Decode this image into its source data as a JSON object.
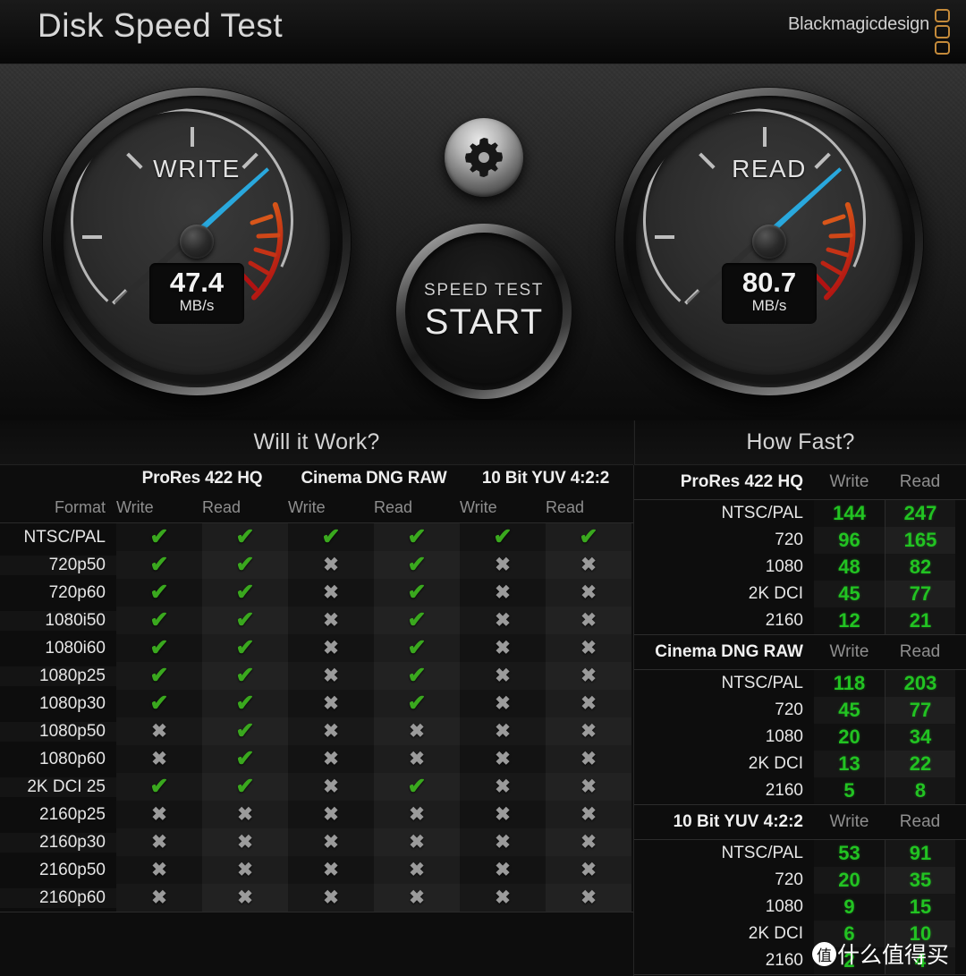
{
  "titlebar": {
    "app_title": "Disk Speed Test",
    "brand": "Blackmagicdesign"
  },
  "gauges": {
    "write": {
      "label": "WRITE",
      "value": "47.4",
      "unit": "MB/s",
      "needle_angle_deg": 228
    },
    "read": {
      "label": "READ",
      "value": "80.7",
      "unit": "MB/s",
      "needle_angle_deg": 228
    }
  },
  "controls": {
    "gear_icon": "gear-icon",
    "start_sub": "SPEED TEST",
    "start_main": "START"
  },
  "sections": {
    "left_title": "Will it Work?",
    "right_title": "How Fast?"
  },
  "will_it_work": {
    "groups": [
      "ProRes 422 HQ",
      "Cinema DNG RAW",
      "10 Bit YUV 4:2:2"
    ],
    "format_header": "Format",
    "sub_headers": [
      "Write",
      "Read",
      "Write",
      "Read",
      "Write",
      "Read"
    ],
    "rows": [
      {
        "format": "NTSC/PAL",
        "cells": [
          "ok",
          "ok",
          "ok",
          "ok",
          "ok",
          "ok"
        ]
      },
      {
        "format": "720p50",
        "cells": [
          "ok",
          "ok",
          "no",
          "ok",
          "no",
          "no"
        ]
      },
      {
        "format": "720p60",
        "cells": [
          "ok",
          "ok",
          "no",
          "ok",
          "no",
          "no"
        ]
      },
      {
        "format": "1080i50",
        "cells": [
          "ok",
          "ok",
          "no",
          "ok",
          "no",
          "no"
        ]
      },
      {
        "format": "1080i60",
        "cells": [
          "ok",
          "ok",
          "no",
          "ok",
          "no",
          "no"
        ]
      },
      {
        "format": "1080p25",
        "cells": [
          "ok",
          "ok",
          "no",
          "ok",
          "no",
          "no"
        ]
      },
      {
        "format": "1080p30",
        "cells": [
          "ok",
          "ok",
          "no",
          "ok",
          "no",
          "no"
        ]
      },
      {
        "format": "1080p50",
        "cells": [
          "no",
          "ok",
          "no",
          "no",
          "no",
          "no"
        ]
      },
      {
        "format": "1080p60",
        "cells": [
          "no",
          "ok",
          "no",
          "no",
          "no",
          "no"
        ]
      },
      {
        "format": "2K DCI 25",
        "cells": [
          "ok",
          "ok",
          "no",
          "ok",
          "no",
          "no"
        ]
      },
      {
        "format": "2160p25",
        "cells": [
          "no",
          "no",
          "no",
          "no",
          "no",
          "no"
        ]
      },
      {
        "format": "2160p30",
        "cells": [
          "no",
          "no",
          "no",
          "no",
          "no",
          "no"
        ]
      },
      {
        "format": "2160p50",
        "cells": [
          "no",
          "no",
          "no",
          "no",
          "no",
          "no"
        ]
      },
      {
        "format": "2160p60",
        "cells": [
          "no",
          "no",
          "no",
          "no",
          "no",
          "no"
        ]
      }
    ],
    "mark_ok_glyph": "✔",
    "mark_no_glyph": "✖"
  },
  "how_fast": {
    "col_write": "Write",
    "col_read": "Read",
    "groups": [
      {
        "name": "ProRes 422 HQ",
        "rows": [
          {
            "format": "NTSC/PAL",
            "write": "144",
            "read": "247"
          },
          {
            "format": "720",
            "write": "96",
            "read": "165"
          },
          {
            "format": "1080",
            "write": "48",
            "read": "82"
          },
          {
            "format": "2K DCI",
            "write": "45",
            "read": "77"
          },
          {
            "format": "2160",
            "write": "12",
            "read": "21"
          }
        ]
      },
      {
        "name": "Cinema DNG RAW",
        "rows": [
          {
            "format": "NTSC/PAL",
            "write": "118",
            "read": "203"
          },
          {
            "format": "720",
            "write": "45",
            "read": "77"
          },
          {
            "format": "1080",
            "write": "20",
            "read": "34"
          },
          {
            "format": "2K DCI",
            "write": "13",
            "read": "22"
          },
          {
            "format": "2160",
            "write": "5",
            "read": "8"
          }
        ]
      },
      {
        "name": "10 Bit YUV 4:2:2",
        "rows": [
          {
            "format": "NTSC/PAL",
            "write": "53",
            "read": "91"
          },
          {
            "format": "720",
            "write": "20",
            "read": "35"
          },
          {
            "format": "1080",
            "write": "9",
            "read": "15"
          },
          {
            "format": "2K DCI",
            "write": "6",
            "read": "10"
          },
          {
            "format": "2160",
            "write": "2",
            "read": "4"
          }
        ]
      }
    ]
  },
  "watermark": {
    "badge": "值",
    "text": "什么值得买"
  },
  "colors": {
    "accent_green": "#22c322",
    "check_green": "#3aa81e",
    "cross_grey": "#9b9b9b",
    "needle_blue": "#29a8dd",
    "brand_orange": "#c48a3a",
    "redzone_start": "#e0661a",
    "redzone_end": "#b01212"
  }
}
